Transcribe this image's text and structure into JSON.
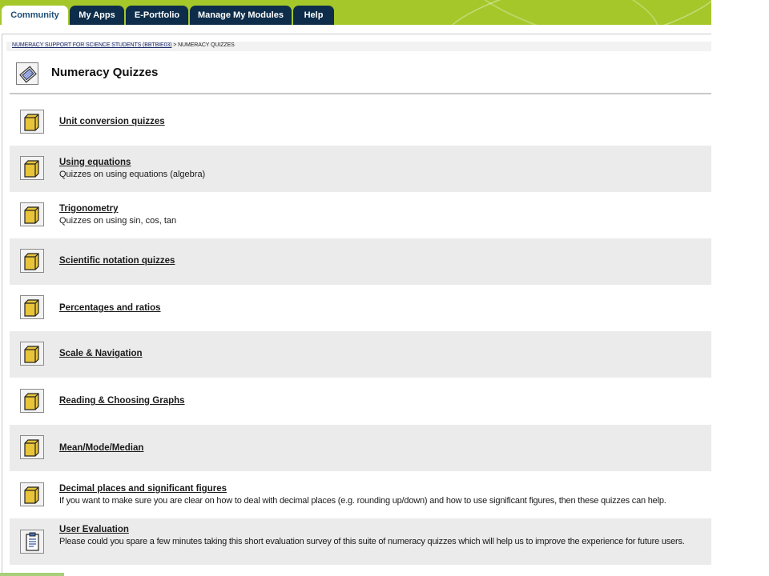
{
  "nav": {
    "tabs": [
      {
        "label": "Community",
        "active": true
      },
      {
        "label": "My Apps",
        "active": false
      },
      {
        "label": "E-Portfolio",
        "active": false
      },
      {
        "label": "Manage My Modules",
        "active": false
      },
      {
        "label": "Help",
        "active": false
      }
    ]
  },
  "breadcrumb": {
    "parent": "NUMERACY SUPPORT FOR SCIENCE STUDENTS (BBTBIE03)",
    "separator": " > ",
    "current": "NUMERACY QUIZZES"
  },
  "page": {
    "title": "Numeracy Quizzes",
    "icon": "quiz-page-icon"
  },
  "items": [
    {
      "title": "Unit conversion quizzes",
      "description": "",
      "icon": "folder-icon"
    },
    {
      "title": "Using equations",
      "description": "Quizzes on using equations (algebra)",
      "icon": "folder-icon"
    },
    {
      "title": "Trigonometry",
      "description": "Quizzes on using sin, cos, tan",
      "icon": "folder-icon"
    },
    {
      "title": "Scientific notation quizzes",
      "description": "",
      "icon": "folder-icon"
    },
    {
      "title": "Percentages and ratios",
      "description": "",
      "icon": "folder-icon"
    },
    {
      "title": "Scale & Navigation",
      "description": "",
      "icon": "folder-icon"
    },
    {
      "title": "Reading & Choosing Graphs",
      "description": "",
      "icon": "folder-icon"
    },
    {
      "title": "Mean/Mode/Median",
      "description": "",
      "icon": "folder-icon"
    },
    {
      "title": "Decimal places and significant figures",
      "description": "If you want to make sure you are clear on how to deal with decimal places (e.g. rounding up/down) and how to use significant figures, then these quizzes can help.",
      "icon": "folder-icon"
    },
    {
      "title": "User Evaluation",
      "description": "Please could you spare a few minutes taking this short evaluation survey of this suite of numeracy quizzes which will help us to improve the experience for future users.",
      "icon": "survey-icon"
    }
  ],
  "colors": {
    "nav_bar": "#a5c72a",
    "tab_dark": "#0d2d4a",
    "row_shade": "#ebebeb",
    "folder": "#e8c43a"
  }
}
